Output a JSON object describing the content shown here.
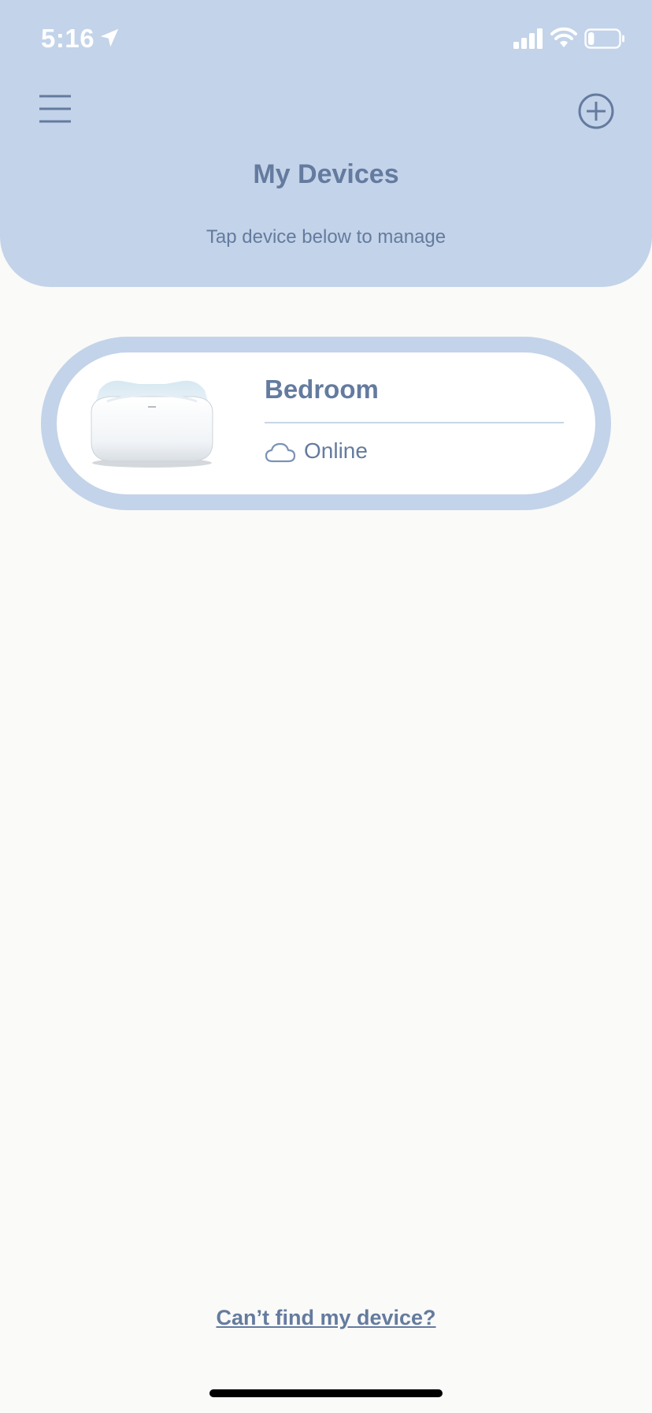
{
  "status_bar": {
    "time": "5:16",
    "icons": [
      "location-arrow-icon",
      "cellular-signal-icon",
      "wifi-icon",
      "battery-icon"
    ],
    "battery_level": 0.2
  },
  "header": {
    "title": "My Devices",
    "subtitle": "Tap device below to manage",
    "menu_icon": "hamburger-menu-icon",
    "add_icon": "add-circle-icon"
  },
  "devices": [
    {
      "name": "Bedroom",
      "status": "Online",
      "status_icon": "cloud-icon",
      "image": "router-device-image"
    }
  ],
  "footer": {
    "help_link": "Can’t find my device?"
  },
  "colors": {
    "header_bg": "#C3D3E9",
    "accent_text": "#647B9F",
    "page_bg": "#FAFAF8",
    "card_bg": "#FFFFFF"
  }
}
